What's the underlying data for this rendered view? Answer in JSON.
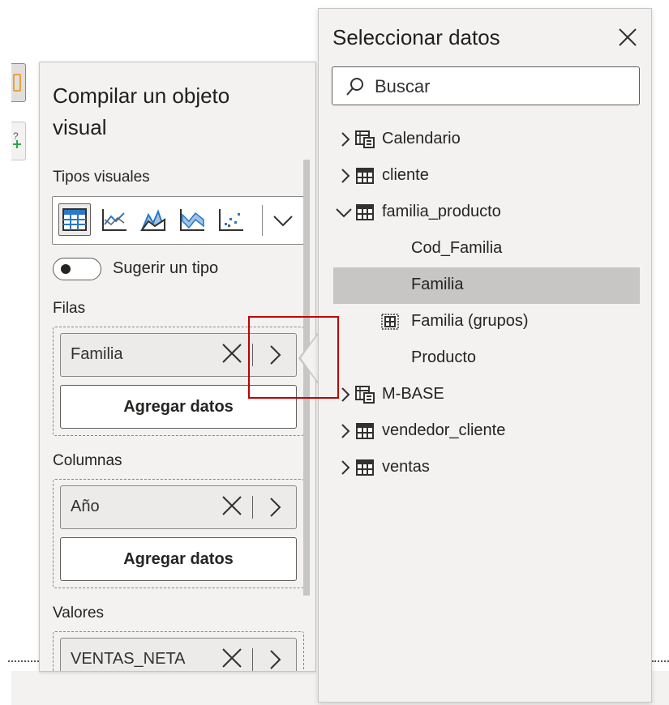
{
  "build_pane": {
    "title": "Compilar un objeto visual",
    "visual_types_label": "Tipos visuales",
    "visual_icons": [
      "matrix-icon",
      "line-chart-icon",
      "area-chart-icon",
      "ribbon-chart-icon",
      "scatter-chart-icon"
    ],
    "suggest_toggle_label": "Sugerir un tipo",
    "suggest_toggle_on": false,
    "rows": {
      "label": "Filas",
      "field": "Familia",
      "add_label": "Agregar datos"
    },
    "columns": {
      "label": "Columnas",
      "field": "Año",
      "add_label": "Agregar datos"
    },
    "values": {
      "label": "Valores",
      "field": "VENTAS_NETA"
    }
  },
  "data_pane": {
    "title": "Seleccionar datos",
    "search_placeholder": "Buscar",
    "tree": [
      {
        "label": "Calendario",
        "icon": "calc-table-icon",
        "expanded": false
      },
      {
        "label": "cliente",
        "icon": "table-icon",
        "expanded": false
      },
      {
        "label": "familia_producto",
        "icon": "table-icon",
        "expanded": true
      },
      {
        "label": "Cod_Familia",
        "icon": "",
        "child": true
      },
      {
        "label": "Familia",
        "icon": "",
        "child": true,
        "selected": true
      },
      {
        "label": "Familia (grupos)",
        "icon": "group-icon",
        "child": true
      },
      {
        "label": "Producto",
        "icon": "",
        "child": true
      },
      {
        "label": "M-BASE",
        "icon": "calc-table-icon",
        "expanded": false
      },
      {
        "label": "vendedor_cliente",
        "icon": "table-icon",
        "expanded": false
      },
      {
        "label": "ventas",
        "icon": "table-icon",
        "expanded": false
      }
    ]
  },
  "colors": {
    "pane_bg": "#f3f2f1",
    "selected_row": "#c8c6c4",
    "highlight": "#c00000",
    "accent": "#0078d4"
  }
}
